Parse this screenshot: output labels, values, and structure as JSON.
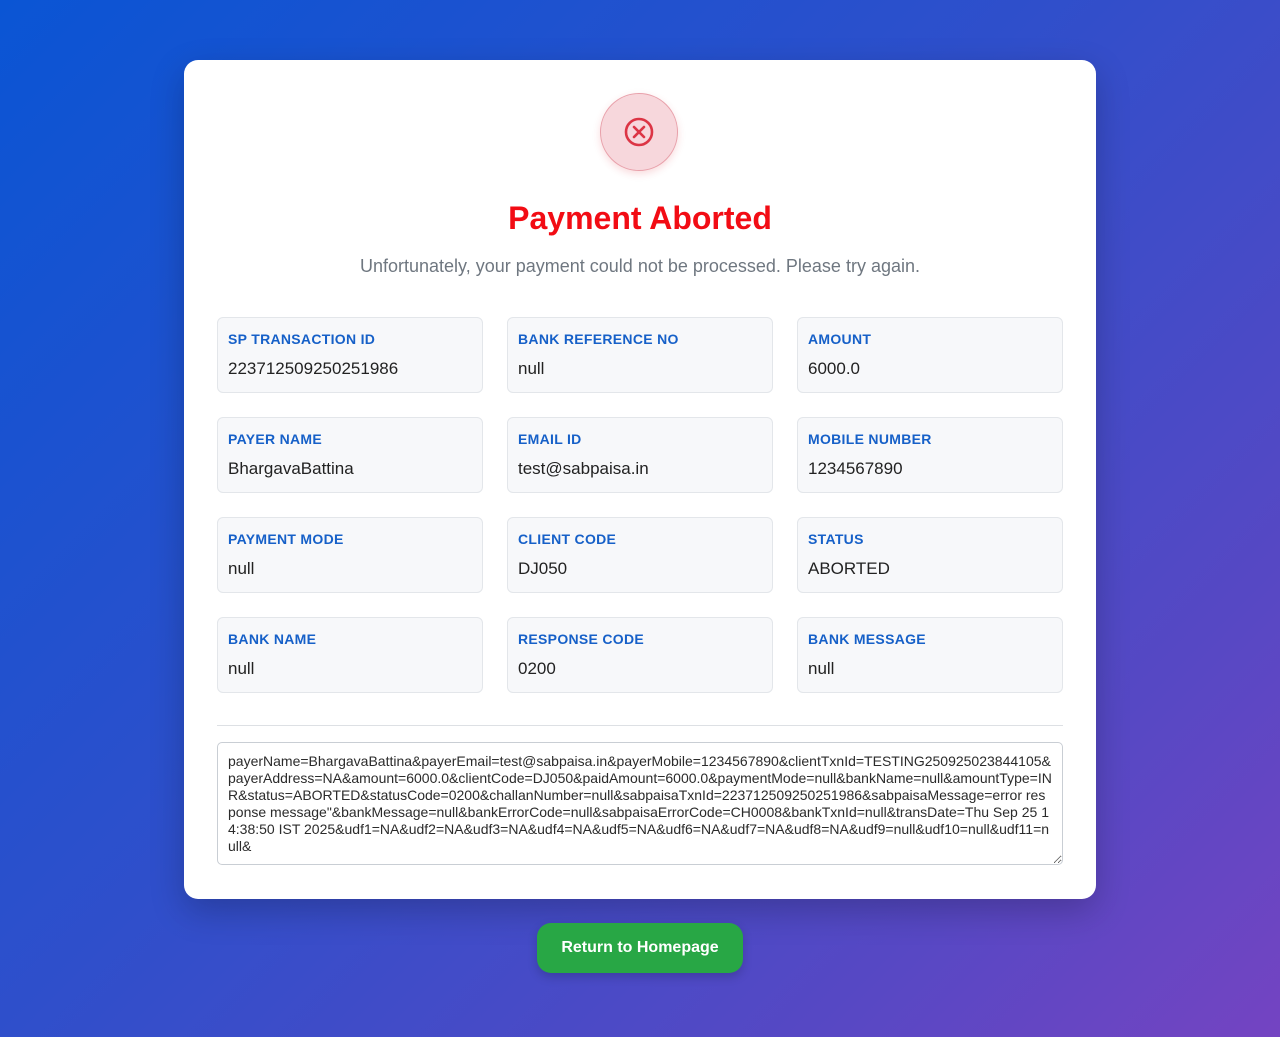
{
  "header": {
    "icon": "x-circle-icon",
    "title": "Payment Aborted",
    "subtitle": "Unfortunately, your payment could not be processed. Please try again."
  },
  "colors": {
    "title": "#f20c14",
    "label": "#1660c8",
    "button": "#28a745",
    "icon_bg": "#f7d7dc"
  },
  "details": [
    {
      "label": "SP TRANSACTION ID",
      "value": "223712509250251986"
    },
    {
      "label": "BANK REFERENCE NO",
      "value": "null"
    },
    {
      "label": "AMOUNT",
      "value": "6000.0"
    },
    {
      "label": "PAYER NAME",
      "value": "BhargavaBattina"
    },
    {
      "label": "EMAIL ID",
      "value": "test@sabpaisa.in"
    },
    {
      "label": "MOBILE NUMBER",
      "value": "1234567890"
    },
    {
      "label": "PAYMENT MODE",
      "value": "null"
    },
    {
      "label": "CLIENT CODE",
      "value": "DJ050"
    },
    {
      "label": "STATUS",
      "value": "ABORTED"
    },
    {
      "label": "BANK NAME",
      "value": "null"
    },
    {
      "label": "RESPONSE CODE",
      "value": "0200"
    },
    {
      "label": "BANK MESSAGE",
      "value": "null"
    }
  ],
  "response_text": "payerName=BhargavaBattina&payerEmail=test@sabpaisa.in&payerMobile=1234567890&clientTxnId=TESTING250925023844105&payerAddress=NA&amount=6000.0&clientCode=DJ050&paidAmount=6000.0&paymentMode=null&bankName=null&amountType=INR&status=ABORTED&statusCode=0200&challanNumber=null&sabpaisaTxnId=223712509250251986&sabpaisaMessage=error response message\"&bankMessage=null&bankErrorCode=null&sabpaisaErrorCode=CH0008&bankTxnId=null&transDate=Thu Sep 25 14:38:50 IST 2025&udf1=NA&udf2=NA&udf3=NA&udf4=NA&udf5=NA&udf6=NA&udf7=NA&udf8=NA&udf9=null&udf10=null&udf11=null&",
  "button": {
    "label": "Return to Homepage"
  }
}
